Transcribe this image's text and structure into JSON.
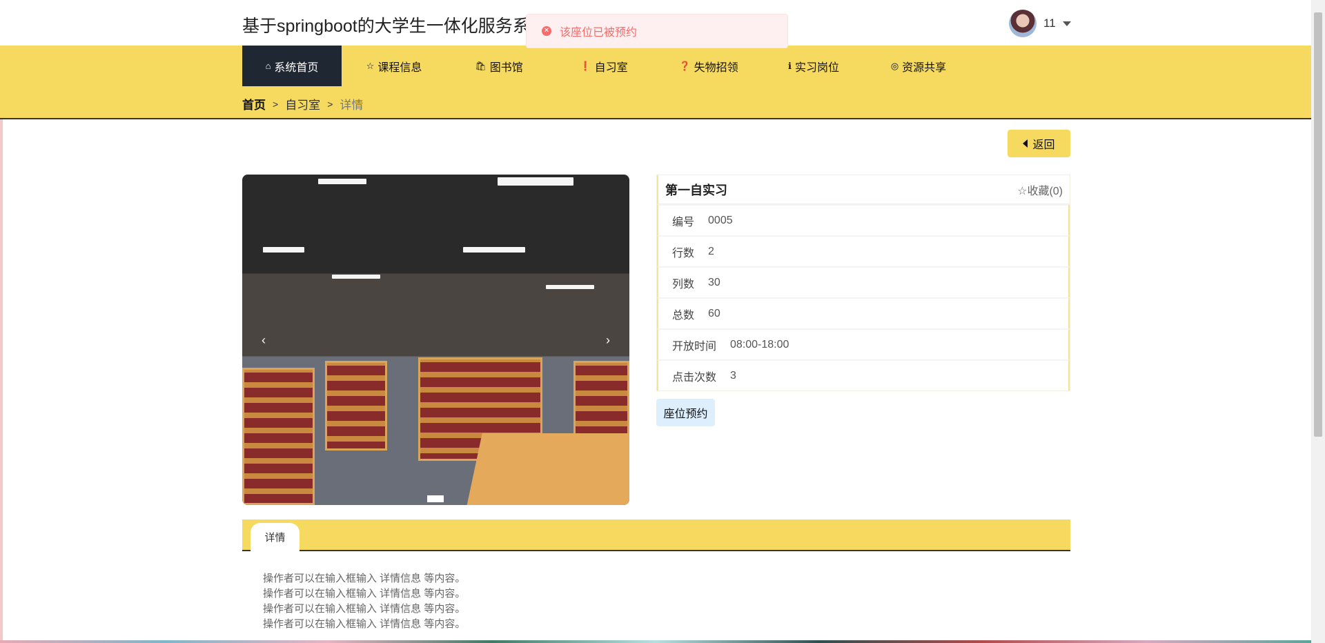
{
  "header": {
    "title": "基于springboot的大学生一体化服务系",
    "user_name": "11"
  },
  "toast": {
    "message": "该座位已被预约"
  },
  "nav": [
    {
      "label": "系统首页",
      "icon": "⌂"
    },
    {
      "label": "课程信息",
      "icon": "☆"
    },
    {
      "label": "图书馆",
      "icon": "🛍"
    },
    {
      "label": "自习室",
      "icon": "❗"
    },
    {
      "label": "失物招领",
      "icon": "❓"
    },
    {
      "label": "实习岗位",
      "icon": "ℹ"
    },
    {
      "label": "资源共享",
      "icon": "◎"
    }
  ],
  "breadcrumb": {
    "home": "首页",
    "parent": "自习室",
    "current": "详情",
    "sep": ">"
  },
  "back_label": "返回",
  "info": {
    "title": "第一自实习",
    "favorite": "☆收藏(0)",
    "rows": [
      {
        "label": "编号",
        "value": "0005"
      },
      {
        "label": "行数",
        "value": "2"
      },
      {
        "label": "列数",
        "value": "30"
      },
      {
        "label": "总数",
        "value": "60"
      },
      {
        "label": "开放时间",
        "value": "08:00-18:00"
      },
      {
        "label": "点击次数",
        "value": "3"
      }
    ]
  },
  "seat_button": "座位预约",
  "carousel": {
    "prev": "‹",
    "next": "›"
  },
  "tab_label": "详情",
  "detail_lines": [
    "操作者可以在输入框输入  详情信息  等内容。",
    "操作者可以在输入框输入  详情信息  等内容。",
    "操作者可以在输入框输入  详情信息  等内容。",
    "操作者可以在输入框输入  详情信息  等内容。"
  ]
}
